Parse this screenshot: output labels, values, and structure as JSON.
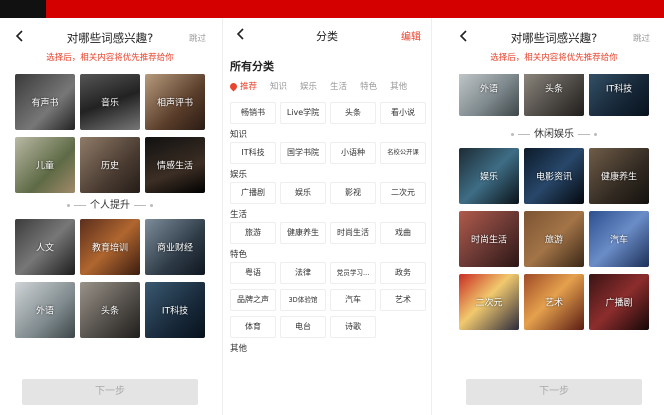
{
  "colors": {
    "accent": "#e8442e",
    "topbar_red": "#d40000",
    "topbar_black": "#111111"
  },
  "screen_left": {
    "title": "对哪些词感兴趣?",
    "skip": "跳过",
    "subtitle": "选择后，相关内容将优先推荐给你",
    "grid1": [
      "有声书",
      "音乐",
      "相声评书",
      "儿童",
      "历史",
      "情感生活"
    ],
    "section": "个人提升",
    "grid2": [
      "人文",
      "教育培训",
      "商业财经",
      "外语",
      "头条",
      "IT科技"
    ],
    "next": "下一步"
  },
  "screen_middle": {
    "title": "分类",
    "edit": "编辑",
    "all_title": "所有分类",
    "tabs": [
      "推荐",
      "知识",
      "娱乐",
      "生活",
      "特色",
      "其他"
    ],
    "groups": [
      {
        "title": "",
        "items": [
          "畅销书",
          "Live学院",
          "头条",
          "看小说"
        ]
      },
      {
        "title": "知识",
        "items": [
          "IT科技",
          "国学书院",
          "小语种",
          "名校公开课"
        ]
      },
      {
        "title": "娱乐",
        "items": [
          "广播剧",
          "娱乐",
          "影视",
          "二次元"
        ]
      },
      {
        "title": "生活",
        "items": [
          "旅游",
          "健康养生",
          "时尚生活",
          "戏曲"
        ]
      },
      {
        "title": "特色",
        "items": [
          "粤语",
          "法律",
          "党员学习...",
          "政务",
          "品牌之声",
          "3D体验馆",
          "汽车",
          "艺术",
          "体育",
          "电台",
          "诗歌"
        ]
      },
      {
        "title": "其他",
        "items": []
      }
    ]
  },
  "screen_right": {
    "title": "对哪些词感兴趣?",
    "skip": "跳过",
    "subtitle": "选择后，相关内容将优先推荐给你",
    "grid_top": [
      "外语",
      "头条",
      "IT科技"
    ],
    "section": "休闲娱乐",
    "grid2": [
      "娱乐",
      "电影资讯",
      "健康养生",
      "时尚生活",
      "旅游",
      "汽车",
      "二次元",
      "艺术",
      "广播剧"
    ],
    "next": "下一步"
  }
}
